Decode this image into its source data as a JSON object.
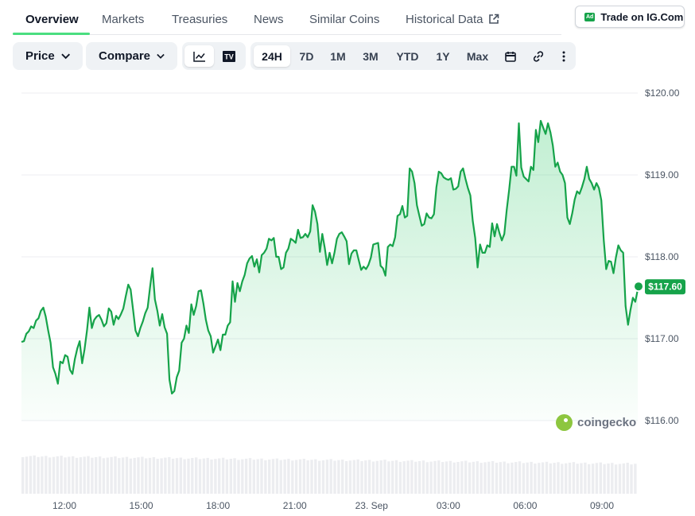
{
  "tabs": [
    {
      "label": "Overview",
      "active": true
    },
    {
      "label": "Markets"
    },
    {
      "label": "Treasuries"
    },
    {
      "label": "News"
    },
    {
      "label": "Similar Coins"
    },
    {
      "label": "Historical Data",
      "icon": "external-link-icon"
    }
  ],
  "ad": {
    "badge": "Ad",
    "label": "Trade on IG.Com"
  },
  "toolbar": {
    "price_label": "Price",
    "compare_label": "Compare",
    "chart_types": [
      "line-chart-icon",
      "tradingview-icon"
    ],
    "ranges": [
      "24H",
      "7D",
      "1M",
      "3M",
      "YTD",
      "1Y",
      "Max"
    ],
    "selected_range": "24H",
    "tools": [
      "calendar-icon",
      "link-icon",
      "more-vertical-icon"
    ]
  },
  "watermark": "coingecko",
  "colors": {
    "line": "#16a34a",
    "accent_green": "#4ade80",
    "price_tag": "#16a34a"
  },
  "chart_data": {
    "type": "area",
    "y_ticks": [
      "$116.00",
      "$117.00",
      "$118.00",
      "$119.00",
      "$120.00"
    ],
    "x_ticks": [
      "12:00",
      "15:00",
      "18:00",
      "21:00",
      "23. Sep",
      "03:00",
      "06:00",
      "09:00"
    ],
    "ylim": [
      116.0,
      120.0
    ],
    "current_price_label": "$117.60",
    "grid": true,
    "series": [
      {
        "values": [
          116.96,
          116.97,
          117.06,
          117.09,
          117.15,
          117.13,
          117.22,
          117.25,
          117.34,
          117.38,
          117.27,
          117.1,
          116.95,
          116.65,
          116.57,
          116.45,
          116.72,
          116.7,
          116.8,
          116.78,
          116.62,
          116.57,
          116.75,
          116.88,
          116.97,
          116.7,
          116.87,
          117.1,
          117.38,
          117.13,
          117.23,
          117.27,
          117.29,
          117.23,
          117.15,
          117.19,
          117.37,
          117.33,
          117.17,
          117.28,
          117.24,
          117.3,
          117.37,
          117.52,
          117.66,
          117.6,
          117.35,
          117.1,
          117.03,
          117.13,
          117.21,
          117.31,
          117.38,
          117.63,
          117.86,
          117.48,
          117.34,
          117.16,
          117.3,
          117.14,
          117.06,
          116.5,
          116.33,
          116.36,
          116.53,
          116.61,
          116.95,
          117.0,
          117.16,
          117.07,
          117.42,
          117.29,
          117.4,
          117.58,
          117.59,
          117.43,
          117.23,
          117.1,
          117.03,
          116.83,
          116.91,
          116.99,
          116.86,
          117.05,
          117.05,
          117.16,
          117.2,
          117.7,
          117.45,
          117.68,
          117.58,
          117.7,
          117.78,
          117.92,
          117.98,
          118.01,
          117.88,
          117.97,
          117.81,
          118.02,
          118.05,
          118.1,
          118.22,
          118.2,
          118.23,
          118.0,
          118.0,
          117.85,
          117.87,
          118.05,
          118.1,
          118.22,
          118.2,
          118.17,
          118.33,
          118.23,
          118.24,
          118.28,
          118.24,
          118.31,
          118.63,
          118.55,
          118.4,
          118.06,
          118.28,
          118.11,
          117.9,
          118.05,
          117.92,
          118.05,
          118.22,
          118.28,
          118.3,
          118.25,
          118.19,
          117.91,
          118.04,
          118.08,
          118.08,
          117.96,
          117.84,
          117.88,
          117.85,
          117.9,
          117.99,
          118.15,
          118.16,
          118.17,
          117.89,
          117.86,
          117.77,
          118.12,
          118.15,
          118.13,
          118.24,
          118.5,
          118.52,
          118.62,
          118.48,
          118.5,
          119.08,
          119.04,
          118.9,
          118.63,
          118.5,
          118.38,
          118.4,
          118.53,
          118.48,
          118.47,
          118.52,
          118.85,
          119.04,
          119.02,
          118.97,
          118.95,
          118.94,
          118.96,
          118.82,
          118.83,
          118.86,
          119.04,
          119.08,
          118.95,
          118.84,
          118.75,
          118.44,
          118.23,
          117.87,
          118.15,
          118.05,
          118.05,
          118.14,
          118.12,
          118.41,
          118.25,
          118.4,
          118.29,
          118.2,
          118.28,
          118.57,
          118.82,
          119.1,
          119.1,
          118.99,
          119.63,
          119.09,
          118.98,
          118.95,
          118.92,
          119.1,
          119.06,
          119.55,
          119.4,
          119.66,
          119.58,
          119.5,
          119.63,
          119.52,
          119.36,
          119.1,
          119.15,
          119.04,
          119.0,
          118.9,
          118.48,
          118.4,
          118.53,
          118.7,
          118.8,
          118.77,
          118.85,
          118.95,
          119.1,
          118.95,
          118.9,
          118.82,
          118.9,
          118.84,
          118.69,
          118.2,
          117.85,
          117.95,
          117.94,
          117.8,
          117.99,
          118.14,
          118.08,
          118.05,
          117.4,
          117.17,
          117.35,
          117.5,
          117.45,
          117.6
        ]
      }
    ]
  }
}
